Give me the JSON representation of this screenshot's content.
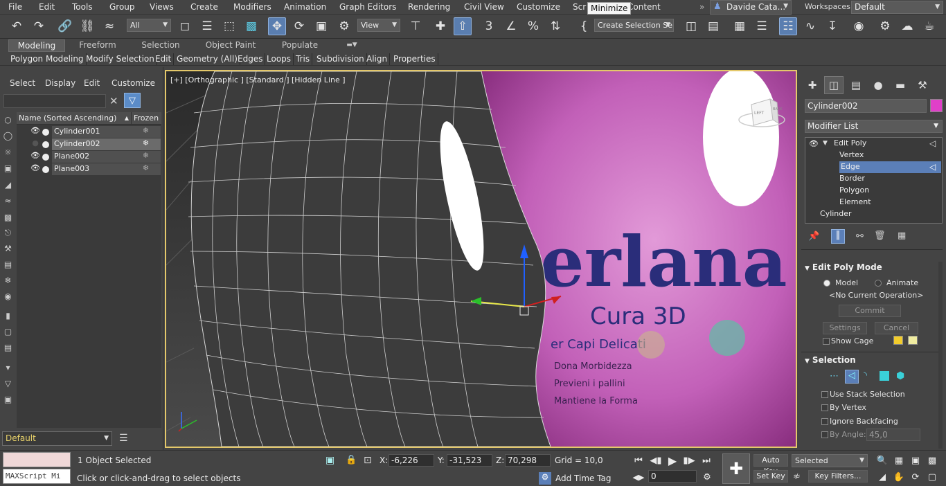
{
  "menu": [
    "File",
    "Edit",
    "Tools",
    "Group",
    "Views",
    "Create",
    "Modifiers",
    "Animation",
    "Graph Editors",
    "Rendering",
    "Civil View",
    "Customize",
    "Scripting",
    "Content"
  ],
  "tooltip": "Minimize",
  "user": "Davide Cata...",
  "workspaces_label": "Workspaces:",
  "workspace": "Default",
  "toolbar": {
    "selection_filter": "All",
    "ref_coord": "View",
    "named_selection": "Create Selection Se"
  },
  "ribbon_tabs": [
    "Modeling",
    "Freeform",
    "Selection",
    "Object Paint",
    "Populate"
  ],
  "ribbon_items": [
    "Polygon Modeling",
    "Modify Selection",
    "Edit",
    "Geometry (All)",
    "Edges",
    "Loops",
    "Tris",
    "Subdivision",
    "Align",
    "Properties"
  ],
  "scene_explorer": {
    "menu": [
      "Select",
      "Display",
      "Edit",
      "Customize"
    ],
    "col_name": "Name (Sorted Ascending)",
    "col_frozen": "Frozen",
    "rows": [
      {
        "name": "Cylinder001"
      },
      {
        "name": "Cylinder002"
      },
      {
        "name": "Plane002"
      },
      {
        "name": "Plane003"
      }
    ],
    "layer": "Default"
  },
  "viewport": {
    "label": "[+] [Orthographic ] [Standard ] [Hidden Line ]",
    "viewcube_left": "LEFT",
    "viewcube_back": "BACK",
    "bottle_text": {
      "brand": "erlana",
      "line": "Cura 3D",
      "subtitle": "er Capi Delicati",
      "l1": "Dona Morbidezza",
      "l2": "Previeni i pallini",
      "l3": "Mantiene la Forma"
    }
  },
  "command_panel": {
    "object_name": "Cylinder002",
    "modifier_list": "Modifier List",
    "stack": [
      "Edit Poly",
      "Vertex",
      "Edge",
      "Border",
      "Polygon",
      "Element",
      "Cylinder"
    ],
    "edit_poly_mode": "Edit Poly Mode",
    "mode_model": "Model",
    "mode_animate": "Animate",
    "no_operation": "<No Current Operation>",
    "commit": "Commit",
    "settings": "Settings",
    "cancel": "Cancel",
    "show_cage": "Show Cage",
    "selection": "Selection",
    "use_stack": "Use Stack Selection",
    "by_vertex": "By Vertex",
    "ignore_backfacing": "Ignore Backfacing",
    "by_angle": "By Angle:",
    "by_angle_value": "45,0"
  },
  "status": {
    "maxscript": "MAXScript Mi",
    "selected": "1 Object Selected",
    "prompt": "Click or click-and-drag to select objects",
    "x_label": "X:",
    "x": "-6,226",
    "y_label": "Y:",
    "y": "-31,523",
    "z_label": "Z:",
    "z": "70,298",
    "grid": "Grid = 10,0",
    "add_time_tag": "Add Time Tag",
    "auto_key": "Auto Key",
    "set_key": "Set Key",
    "key_mode": "Selected",
    "key_filters": "Key Filters...",
    "frame": "0"
  },
  "colors": {
    "accent": "#5b7fb8",
    "viewport_border": "#e4c86a",
    "object_color": "#e040c8",
    "cage1": "#f2cc2c",
    "cage2": "#f0eca0"
  }
}
